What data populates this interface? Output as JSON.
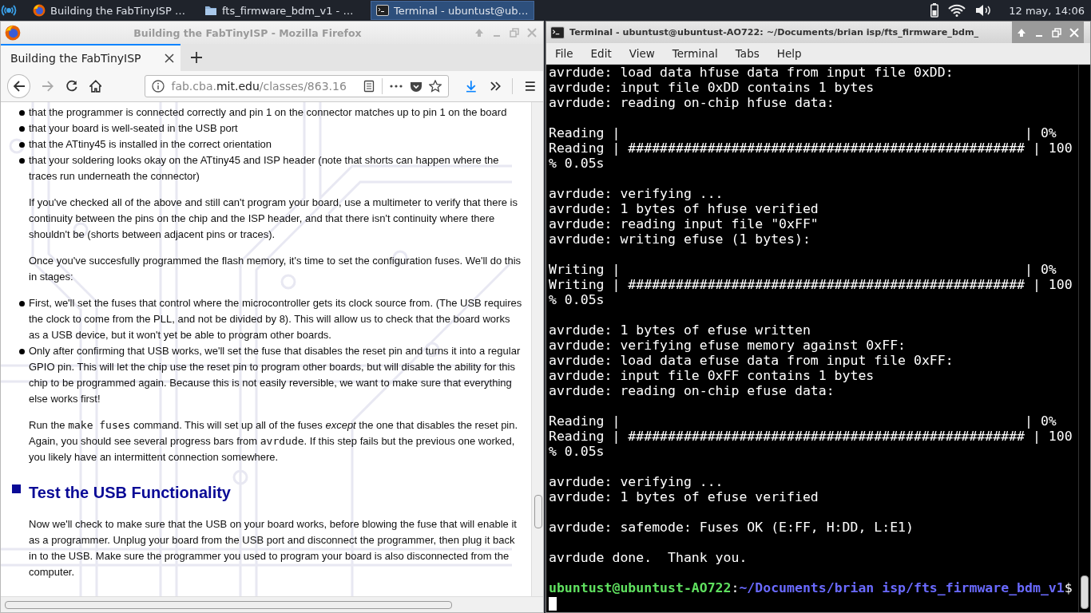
{
  "taskbar": {
    "tasks": [
      {
        "kind": "firefox",
        "label": "Building the FabTinyISP …",
        "selected": false
      },
      {
        "kind": "folder",
        "label": "fts_firmware_bdm_v1 - …",
        "selected": false
      },
      {
        "kind": "terminal",
        "label": "Terminal - ubuntust@ub…",
        "selected": true
      }
    ],
    "clock": "12 may, 14:06"
  },
  "firefox": {
    "title": "Building the FabTinyISP - Mozilla Firefox",
    "tab": {
      "label": "Building the FabTinyISP"
    },
    "url": {
      "prefix": "fab.cba.",
      "domain": "mit.edu",
      "path": "/classes/863.16"
    },
    "content": [
      {
        "kind": "list",
        "items": [
          "that the programmer is connected correctly and pin 1 on the connector matches up to pin 1 on the board",
          "that your board is well-seated in the USB port",
          "that the ATtiny45 is installed in the correct orientation",
          "that your soldering looks okay on the ATtiny45 and ISP header (note that shorts can happen where the traces run underneath the connector)"
        ]
      },
      {
        "kind": "para",
        "parts": [
          {
            "kind": "text",
            "text": "If you've checked all of the above and still can't program your board, use a multimeter to verify that there is continuity between the pins on the chip and the ISP header, and that there isn't continuity where there shouldn't be (shorts between adjacent pins or traces)."
          }
        ]
      },
      {
        "kind": "para",
        "parts": [
          {
            "kind": "text",
            "text": "Once you've succesfully programmed the flash memory, it's time to set the configuration fuses. We'll do this in stages:"
          }
        ]
      },
      {
        "kind": "list",
        "items": [
          "First, we'll set the fuses that control where the microcontroller gets its clock source from. (The USB requires the clock to come from the PLL, and not be divided by 8). This will allow us to check that the board works as a USB device, but it won't yet be able to program other boards.",
          "Only after confirming that USB works, we'll set the fuse that disables the reset pin and turns it into a regular GPIO pin. This will let the chip use the reset pin to program other boards, but will disable the ability for this chip to be programmed again. Because this is not easily reversible, we want to make sure that everything else works first!"
        ]
      },
      {
        "kind": "para",
        "parts": [
          {
            "kind": "text",
            "text": "Run the "
          },
          {
            "kind": "code",
            "text": "make fuses"
          },
          {
            "kind": "text",
            "text": " command. This will set up all of the fuses *except* the one that disables the reset pin. Again, you should see several progress bars from "
          },
          {
            "kind": "code",
            "text": "avrdude"
          },
          {
            "kind": "text",
            "text": ". If this step fails but the previous one worked, you likely have an intermittent connection somewhere."
          }
        ]
      },
      {
        "kind": "heading",
        "text": "Test the USB Functionality"
      },
      {
        "kind": "para",
        "parts": [
          {
            "kind": "text",
            "text": "Now we'll check to make sure that the USB on your board works, before blowing the fuse that will enable it as a programmer. Unplug your board from the USB port and disconnect the programmer, then plug it back in to the USB. Make sure the programmer you used to program your board is also disconnected from the computer."
          }
        ]
      }
    ]
  },
  "terminal": {
    "title": "Terminal - ubuntust@ubuntust-AO722: ~/Documents/brian isp/fts_firmware_bdm_",
    "menu": [
      "File",
      "Edit",
      "View",
      "Terminal",
      "Tabs",
      "Help"
    ],
    "lines": [
      {
        "kind": "text",
        "text": "avrdude: load data hfuse data from input file 0xDD:"
      },
      {
        "kind": "text",
        "text": "avrdude: input file 0xDD contains 1 bytes"
      },
      {
        "kind": "text",
        "text": "avrdude: reading on-chip hfuse data:"
      },
      {
        "kind": "blank"
      },
      {
        "kind": "text",
        "text": "Reading |                                                   | 0%"
      },
      {
        "kind": "text",
        "text": "Reading | ################################################## | 100"
      },
      {
        "kind": "text",
        "text": "% 0.05s"
      },
      {
        "kind": "blank"
      },
      {
        "kind": "text",
        "text": "avrdude: verifying ..."
      },
      {
        "kind": "text",
        "text": "avrdude: 1 bytes of hfuse verified"
      },
      {
        "kind": "text",
        "text": "avrdude: reading input file \"0xFF\""
      },
      {
        "kind": "text",
        "text": "avrdude: writing efuse (1 bytes):"
      },
      {
        "kind": "blank"
      },
      {
        "kind": "text",
        "text": "Writing |                                                   | 0%"
      },
      {
        "kind": "text",
        "text": "Writing | ################################################## | 100"
      },
      {
        "kind": "text",
        "text": "% 0.05s"
      },
      {
        "kind": "blank"
      },
      {
        "kind": "text",
        "text": "avrdude: 1 bytes of efuse written"
      },
      {
        "kind": "text",
        "text": "avrdude: verifying efuse memory against 0xFF:"
      },
      {
        "kind": "text",
        "text": "avrdude: load data efuse data from input file 0xFF:"
      },
      {
        "kind": "text",
        "text": "avrdude: input file 0xFF contains 1 bytes"
      },
      {
        "kind": "text",
        "text": "avrdude: reading on-chip efuse data:"
      },
      {
        "kind": "blank"
      },
      {
        "kind": "text",
        "text": "Reading |                                                   | 0%"
      },
      {
        "kind": "text",
        "text": "Reading | ################################################## | 100"
      },
      {
        "kind": "text",
        "text": "% 0.05s"
      },
      {
        "kind": "blank"
      },
      {
        "kind": "text",
        "text": "avrdude: verifying ..."
      },
      {
        "kind": "text",
        "text": "avrdude: 1 bytes of efuse verified"
      },
      {
        "kind": "blank"
      },
      {
        "kind": "text",
        "text": "avrdude: safemode: Fuses OK (E:FF, H:DD, L:E1)"
      },
      {
        "kind": "blank"
      },
      {
        "kind": "text",
        "text": "avrdude done.  Thank you."
      },
      {
        "kind": "blank"
      }
    ],
    "prompt": {
      "user": "ubuntust@ubuntust-AO722",
      "separator": ":",
      "path": "~/Documents/brian isp/fts_firmware_bdm_v1",
      "symbol": "$"
    }
  }
}
